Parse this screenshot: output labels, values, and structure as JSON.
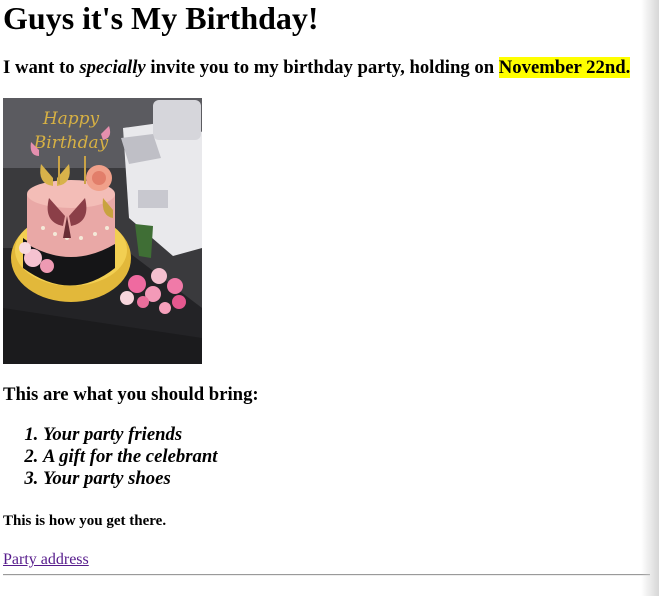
{
  "heading": "Guys it's My Birthday!",
  "intro": {
    "before": "I want to ",
    "emphasis": "specially",
    "middle": " invite you to my birthday party, holding on ",
    "highlight": "November 22nd."
  },
  "photo": {
    "topper_line1": "Happy",
    "topper_line2": "Birthday"
  },
  "bring": {
    "heading": "This are what you should bring:",
    "items": [
      "Your party friends",
      "A gift for the celebrant",
      "Your party shoes"
    ]
  },
  "directions": "This is how you get there.",
  "address_link": "Party address",
  "colors": {
    "highlight": "#ffff00",
    "visited_link": "#551a8b"
  }
}
